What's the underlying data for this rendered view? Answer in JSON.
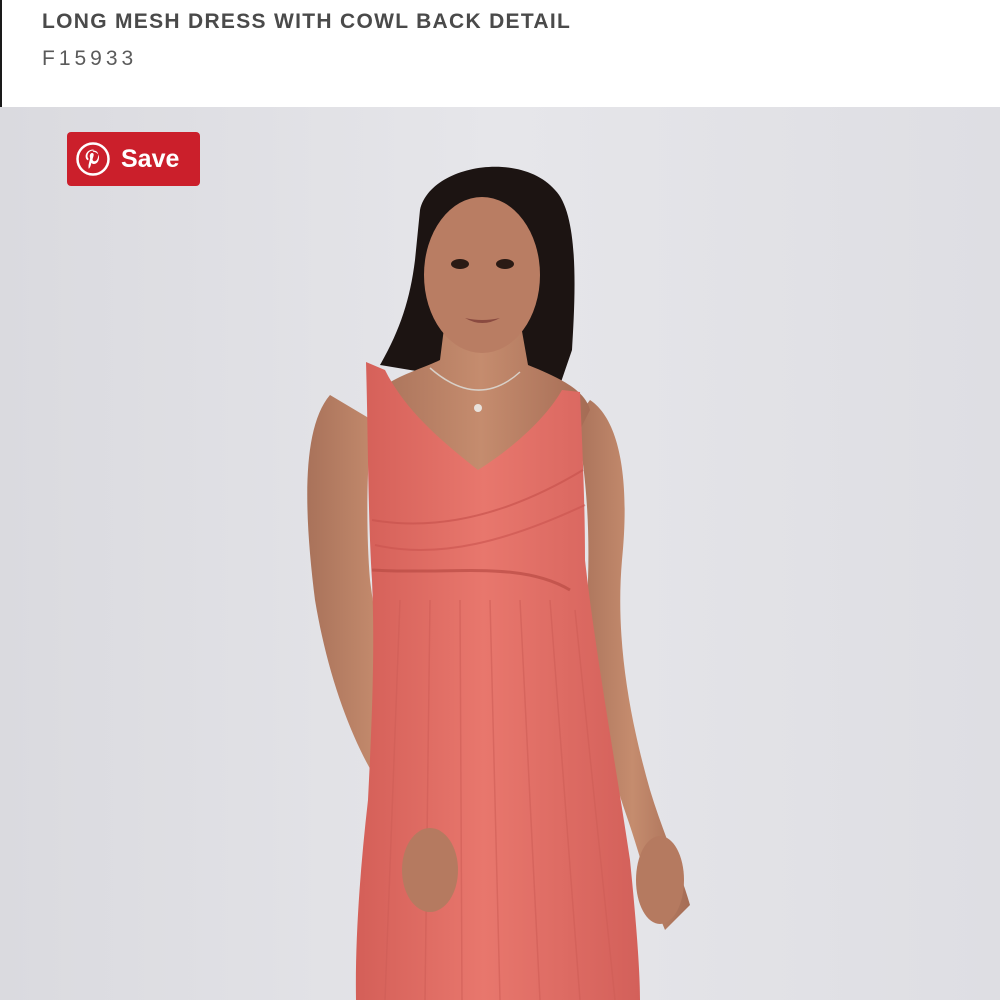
{
  "product": {
    "title": "LONG MESH DRESS WITH COWL BACK DETAIL",
    "sku": "F15933"
  },
  "save_button": {
    "label": "Save",
    "icon": "pinterest-icon",
    "color": "#cb1f2b"
  },
  "colors": {
    "photo_background": "#e1e1e6",
    "dress": "#e26f66",
    "title_text": "#4a4a4a"
  }
}
